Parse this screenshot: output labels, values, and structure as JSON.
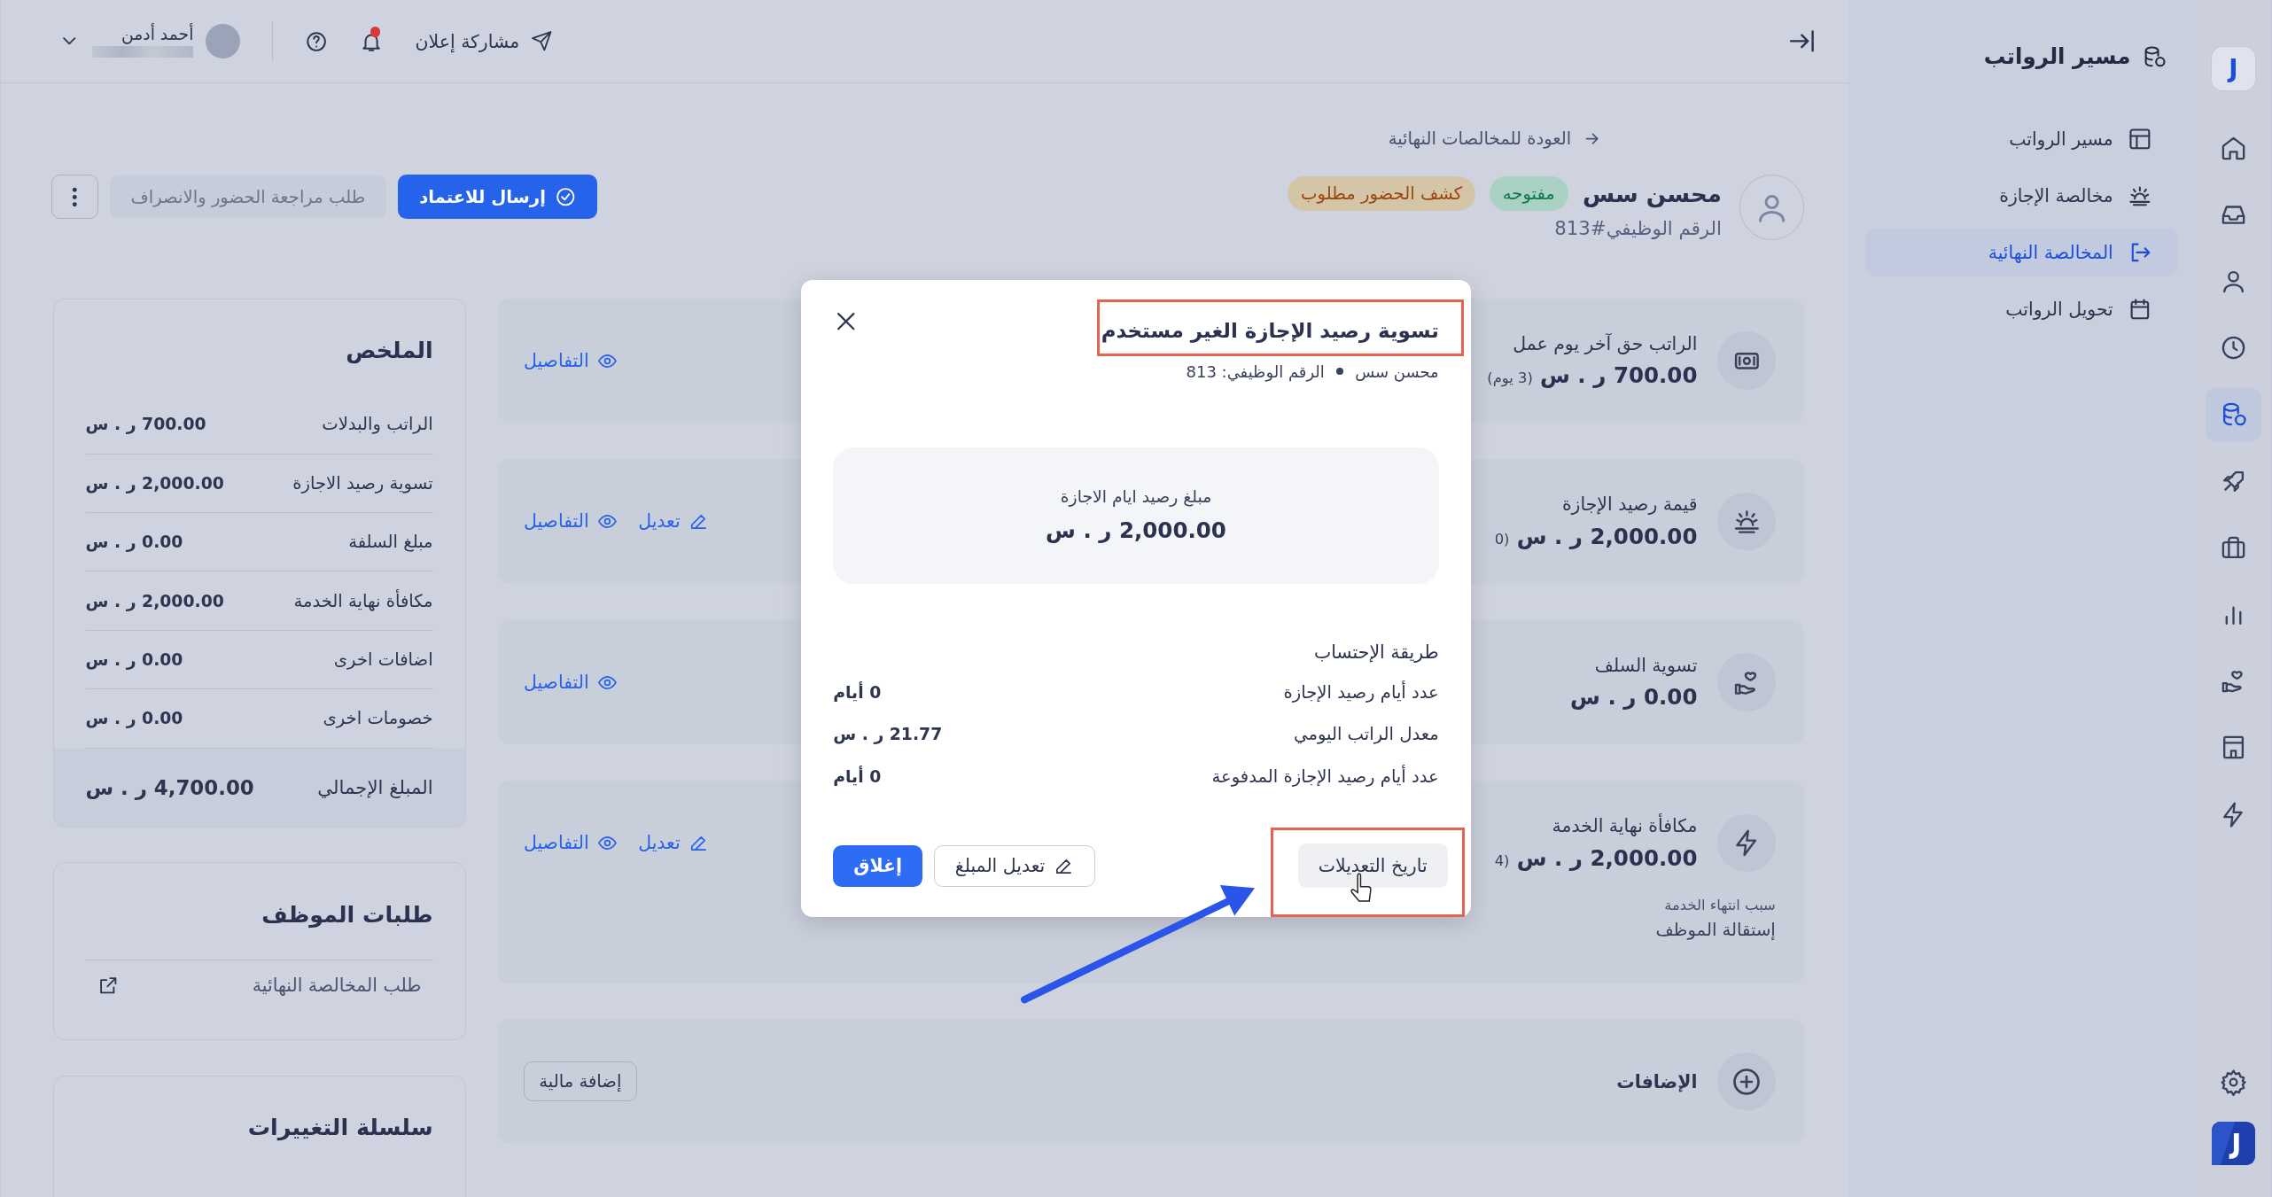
{
  "rail": {
    "logo": "J",
    "items": [
      {
        "selected": false
      },
      {
        "selected": false
      },
      {
        "selected": false
      },
      {
        "selected": false
      },
      {
        "selected": true
      },
      {
        "selected": false
      },
      {
        "selected": false
      },
      {
        "selected": false
      },
      {
        "selected": false
      },
      {
        "selected": false
      },
      {
        "selected": false
      }
    ]
  },
  "sidebar": {
    "title": "مسير الرواتب",
    "items": [
      {
        "label": "مسير الرواتب",
        "selected": false
      },
      {
        "label": "مخالصة الإجازة",
        "selected": false
      },
      {
        "label": "المخالصة النهائية",
        "selected": true
      },
      {
        "label": "تحويل الرواتب",
        "selected": false
      }
    ]
  },
  "topbar": {
    "share": "مشاركة إعلان",
    "notifications_unread": true,
    "user": {
      "name": "أحمد أدمن"
    }
  },
  "back_link": "العودة للمخالصات النهائية",
  "employee": {
    "name": "محسن سس",
    "number": "الرقم الوظيفي#813",
    "badges": [
      {
        "label": "مفتوحه",
        "kind": "success"
      },
      {
        "label": "كشف الحضور مطلوب",
        "kind": "warning"
      }
    ]
  },
  "actions": [
    {
      "label": "إرسال للاعتماد",
      "kind": "primary",
      "disabled": false
    },
    {
      "label": "طلب مراجعة الحضور والانصراف",
      "kind": "secondary",
      "disabled": true
    }
  ],
  "cards": [
    {
      "title": "الراتب حق آخر يوم عمل",
      "amount": "700.00 ر . س",
      "note": "(3 يوم)",
      "actions": [
        {
          "label": "التفاصيل",
          "kind": "details"
        }
      ]
    },
    {
      "title": "قيمة رصيد الإجازة",
      "amount": "2,000.00 ر . س",
      "note": "(0",
      "actions": [
        {
          "label": "تعديل",
          "kind": "edit"
        },
        {
          "label": "التفاصيل",
          "kind": "details"
        }
      ]
    },
    {
      "title": "تسوية السلف",
      "amount": "0.00 ر . س",
      "actions": [
        {
          "label": "التفاصيل",
          "kind": "details"
        }
      ]
    },
    {
      "title": "مكافأة نهاية الخدمة",
      "amount": "2,000.00 ر . س",
      "note": "(4",
      "reason_label": "سبب انتهاء الخدمة",
      "reason": "إستقالة الموظف",
      "actions": [
        {
          "label": "تعديل",
          "kind": "edit"
        },
        {
          "label": "التفاصيل",
          "kind": "details"
        }
      ]
    }
  ],
  "additions": {
    "title": "الإضافات",
    "button": "إضافة مالية"
  },
  "summary": {
    "title": "الملخص",
    "rows": [
      {
        "label": "الراتب والبدلات",
        "value": "700.00 ر . س"
      },
      {
        "label": "تسوية رصيد الاجازة",
        "value": "2,000.00 ر . س"
      },
      {
        "label": "مبلغ السلفة",
        "value": "0.00 ر . س"
      },
      {
        "label": "مكافأة نهاية الخدمة",
        "value": "2,000.00 ر . س"
      },
      {
        "label": "اضافات اخرى",
        "value": "0.00 ر . س"
      },
      {
        "label": "خصومات اخرى",
        "value": "0.00 ر . س"
      }
    ],
    "total": {
      "label": "المبلغ الإجمالي",
      "value": "4,700.00 ر . س"
    }
  },
  "requests": {
    "title": "طلبات الموظف",
    "items": [
      "طلب المخالصة النهائية"
    ]
  },
  "changes": {
    "title": "سلسلة التغييرات"
  },
  "modal": {
    "title": "تسوية رصيد الإجازة الغير مستخدم",
    "employee": "محسن سس",
    "number": "الرقم الوظيفي: 813",
    "amount_label": "مبلغ رصيد ايام الاجازة",
    "amount": "2,000.00 ر . س",
    "method_title": "طريقة الإحتساب",
    "rows": [
      {
        "label": "عدد أيام رصيد الإجازة",
        "value": "0 أيام"
      },
      {
        "label": "معدل الراتب اليومي",
        "value": "21.77 ر . س"
      },
      {
        "label": "عدد أيام رصيد الإجازة المدفوعة",
        "value": "0 أيام"
      }
    ],
    "history_button": "تاريخ التعديلات",
    "edit_button": "تعديل المبلغ",
    "close_button": "إغلاق"
  }
}
